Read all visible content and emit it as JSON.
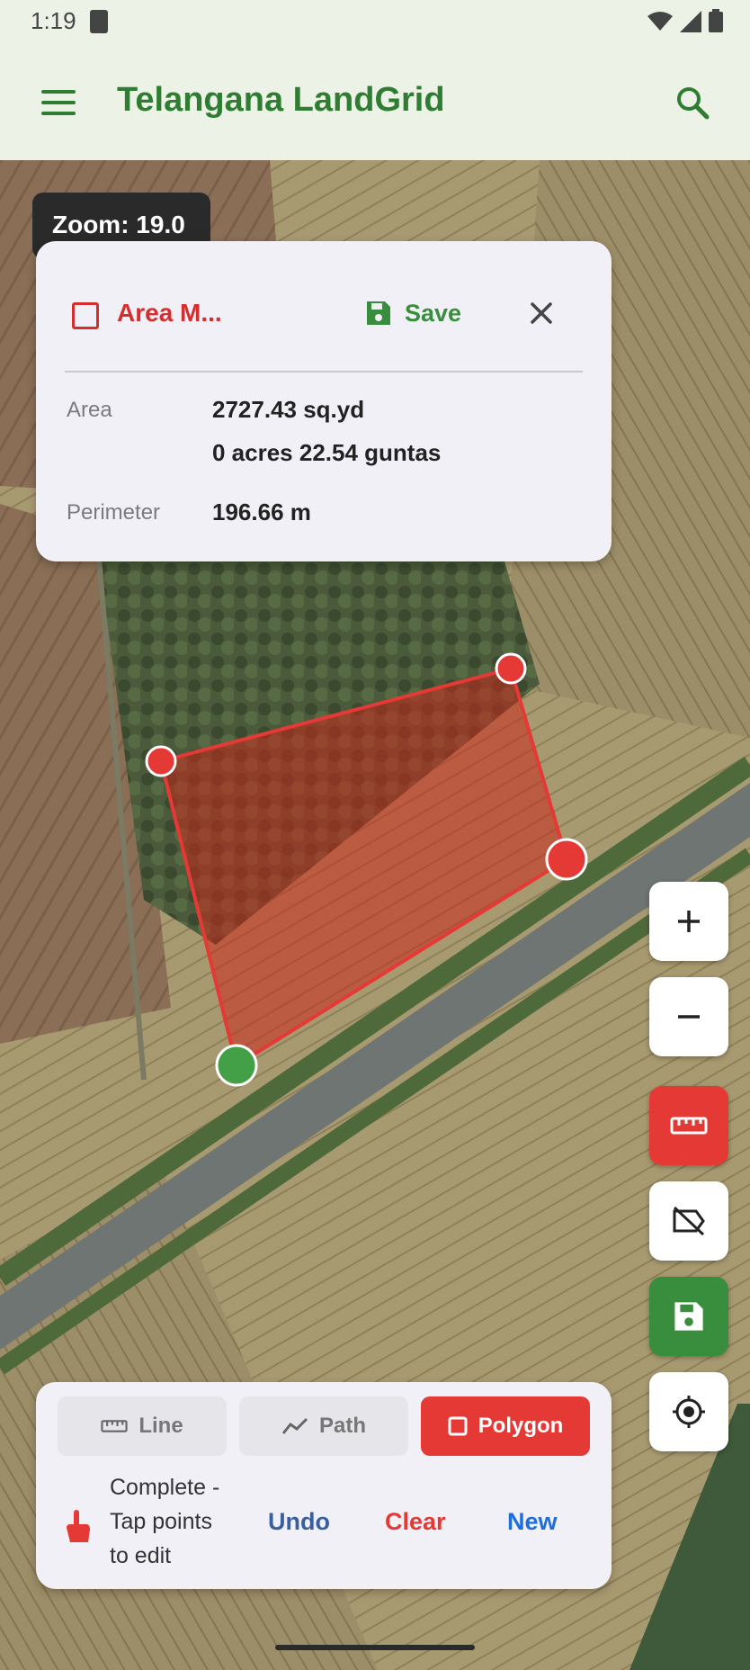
{
  "status_bar": {
    "time": "1:19"
  },
  "app_bar": {
    "title": "Telangana LandGrid"
  },
  "map": {
    "zoom_label": "Zoom: 19.0"
  },
  "measure_card": {
    "title": "Area M...",
    "save_label": "Save",
    "area_label": "Area",
    "area_sqyd": "2727.43 sq.yd",
    "area_acres": "0 acres 22.54 guntas",
    "perimeter_label": "Perimeter",
    "perimeter_value": "196.66 m"
  },
  "mode_selector": {
    "modes": [
      {
        "label": "Line",
        "icon": "ruler-icon"
      },
      {
        "label": "Path",
        "icon": "trend-line-icon"
      },
      {
        "label": "Polygon",
        "icon": "square-icon",
        "active": true
      }
    ]
  },
  "bottom_panel": {
    "hint_line1": "Complete -",
    "hint_line2": "Tap points",
    "hint_line3": "to edit",
    "undo_label": "Undo",
    "clear_label": "Clear",
    "new_label": "New"
  },
  "colors": {
    "brand_green": "#2e7d32",
    "measure_red": "#e53935",
    "undo_blue": "#3a5fa0",
    "new_blue": "#1e6fd9"
  }
}
